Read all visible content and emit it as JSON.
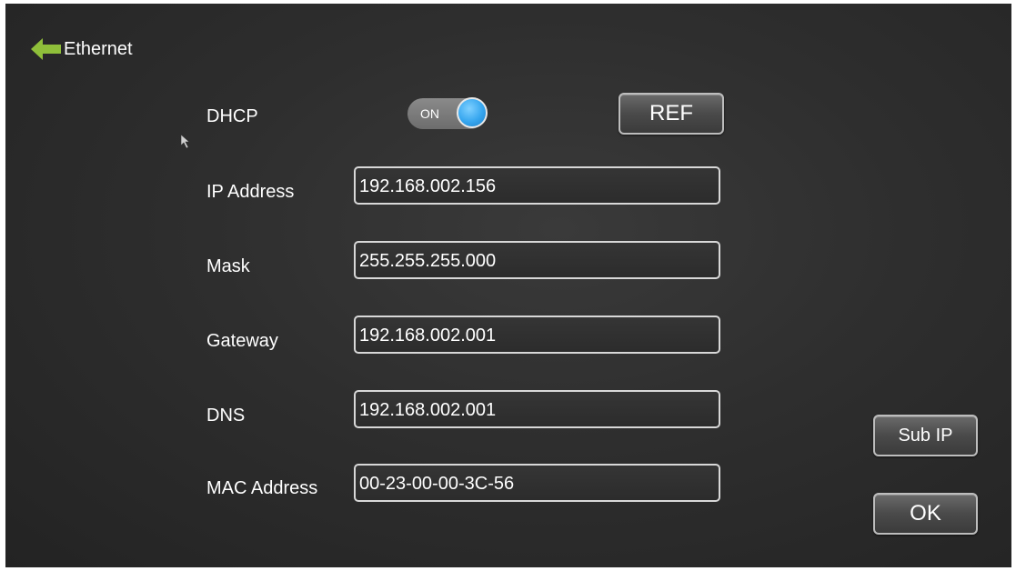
{
  "header": {
    "back_icon": "left-arrow-icon",
    "title": "Ethernet",
    "back_icon_color": "#8fbf3a"
  },
  "dhcp": {
    "label": "DHCP",
    "toggle_text": "ON",
    "state": "on",
    "knob_color": "#36a6ef"
  },
  "buttons": {
    "ref": "REF",
    "sub_ip": "Sub IP",
    "ok": "OK"
  },
  "fields": [
    {
      "label": "IP Address",
      "value": "192.168.002.156"
    },
    {
      "label": "Mask",
      "value": "255.255.255.000"
    },
    {
      "label": "Gateway",
      "value": "192.168.002.001"
    },
    {
      "label": "DNS",
      "value": "192.168.002.001"
    },
    {
      "label": "MAC Address",
      "value": "00-23-00-00-3C-56"
    }
  ],
  "pointer_icon": "mouse-pointer-icon"
}
